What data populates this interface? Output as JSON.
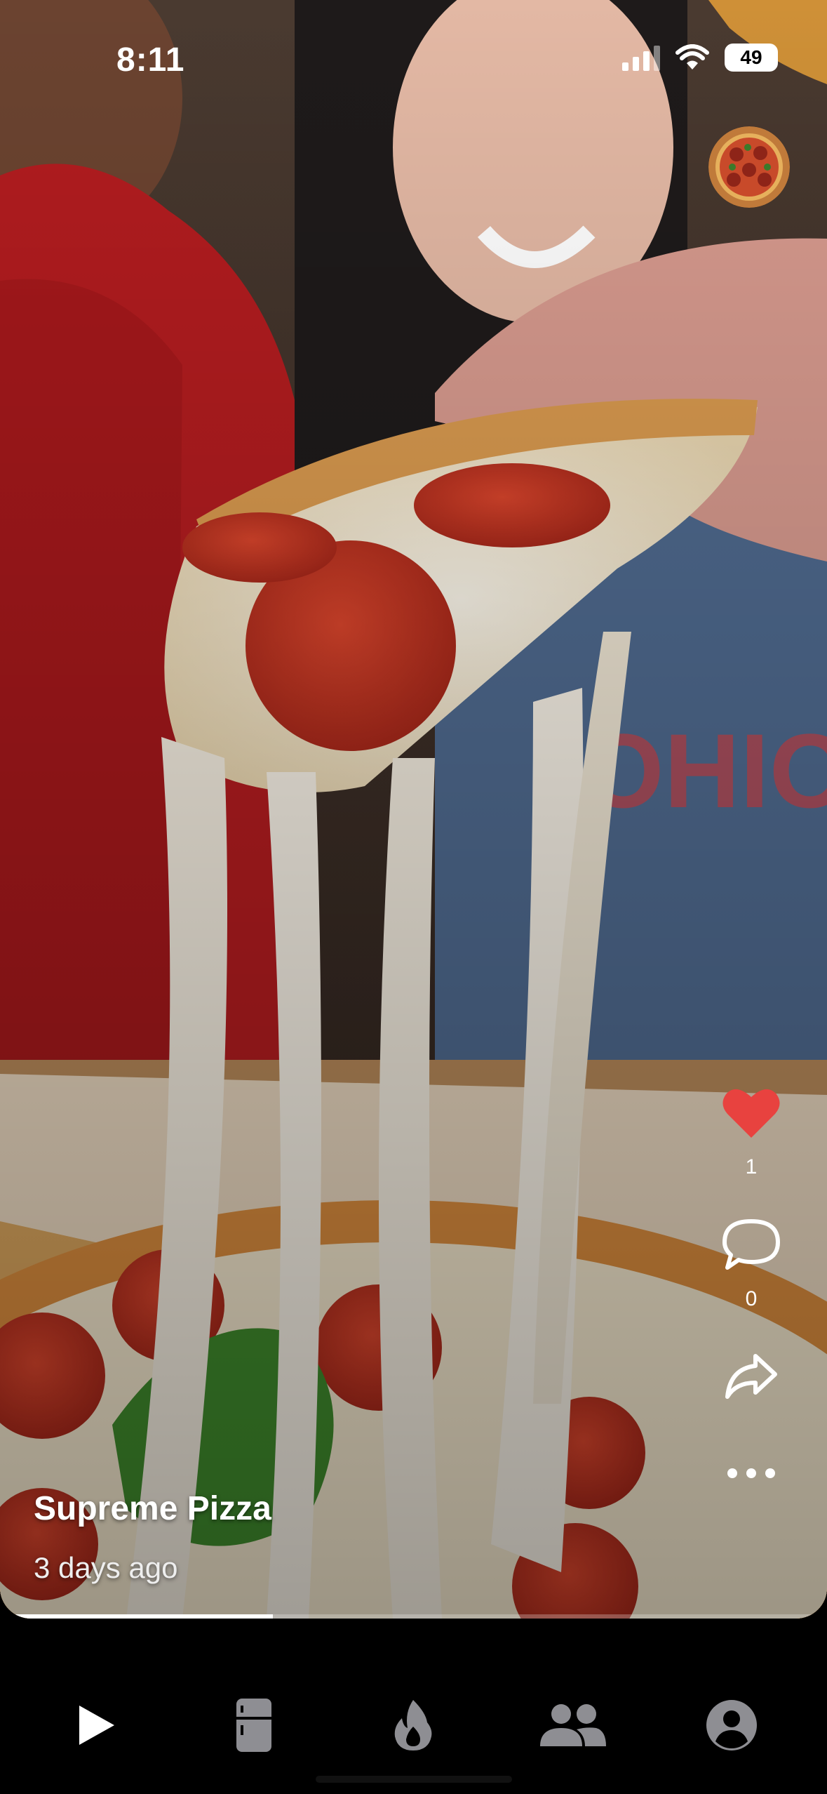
{
  "status_bar": {
    "time": "8:11",
    "battery": "49"
  },
  "post": {
    "title": "Supreme Pizza",
    "posted": "3 days ago",
    "likes": "1",
    "comments": "0",
    "like_color": "#e8423f",
    "progress": 0.33
  },
  "tabs": [
    {
      "icon": "play-icon",
      "active": true
    },
    {
      "icon": "fridge-icon",
      "active": false
    },
    {
      "icon": "fire-icon",
      "active": false
    },
    {
      "icon": "people-icon",
      "active": false
    },
    {
      "icon": "profile-icon",
      "active": false
    }
  ],
  "colors": {
    "active_tab": "#ffffff",
    "inactive_tab": "#8e8e93"
  }
}
